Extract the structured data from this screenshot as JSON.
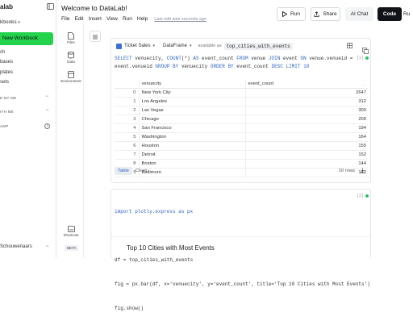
{
  "sidebar": {
    "logo": "alab",
    "workbooks_label": "kbooks",
    "new_workbook": "New Workbook",
    "items": [
      "ch",
      "bases",
      "plates",
      "sets"
    ],
    "sections": [
      "D BY ME",
      "ITH ME",
      "AMP"
    ],
    "user": "Schouwenaars"
  },
  "rail": {
    "files": "Files",
    "data": "Data",
    "environment": "Environment",
    "shortcuts": "Shortcuts",
    "beta": "BETA"
  },
  "header": {
    "title": "Welcome to DataLab!",
    "menu": [
      "File",
      "Edit",
      "Insert",
      "View",
      "Run",
      "Help"
    ],
    "saved": "Last edit was seconds ago",
    "run": "Run",
    "share": "Share",
    "ai_chat": "AI Chat",
    "code": "Code",
    "run_right": "Ru"
  },
  "sql_cell": {
    "source": "Ticket Sales",
    "output_type": "DataFrame",
    "available_as": "available as",
    "var_name": "top_cities_with_events",
    "index_label": "[1]",
    "query_line1": "SELECT venuecity, COUNT(*) AS event_count FROM venue JOIN event ON venue.venueid =",
    "query_line2": "event.venueid GROUP BY venuecity ORDER BY event_count DESC LIMIT 10"
  },
  "table": {
    "columns": [
      "venuecity",
      "event_count"
    ],
    "col_subs": [
      "...",
      "..."
    ],
    "rows": [
      {
        "i": "0",
        "city": "New York City",
        "count": "2647"
      },
      {
        "i": "1",
        "city": "Los Angeles",
        "count": "312"
      },
      {
        "i": "2",
        "city": "Las Vegas",
        "count": "300"
      },
      {
        "i": "3",
        "city": "Chicago",
        "count": "209"
      },
      {
        "i": "4",
        "city": "San Francisco",
        "count": "194"
      },
      {
        "i": "5",
        "city": "Washington",
        "count": "164"
      },
      {
        "i": "6",
        "city": "Houston",
        "count": "155"
      },
      {
        "i": "7",
        "city": "Detroit",
        "count": "152"
      },
      {
        "i": "8",
        "city": "Boston",
        "count": "144"
      },
      {
        "i": "9",
        "city": "Baltimore",
        "count": "142"
      }
    ],
    "tab_table": "Table",
    "tab_chart": "Chart",
    "row_count": "10 rows"
  },
  "py_cell": {
    "index_label": "[2]",
    "lines": [
      "import plotly.express as px",
      "",
      "df = top_cities_with_events",
      "fig = px.bar(df, x='venuecity', y='event_count', title='Top 10 Cities with Most Events')",
      "fig.show()"
    ],
    "plot_title": "Top 10 Cities with Most Events"
  },
  "colors": {
    "accent": "#22d34b",
    "link": "#2f63c7",
    "dark_button": "#101318"
  }
}
